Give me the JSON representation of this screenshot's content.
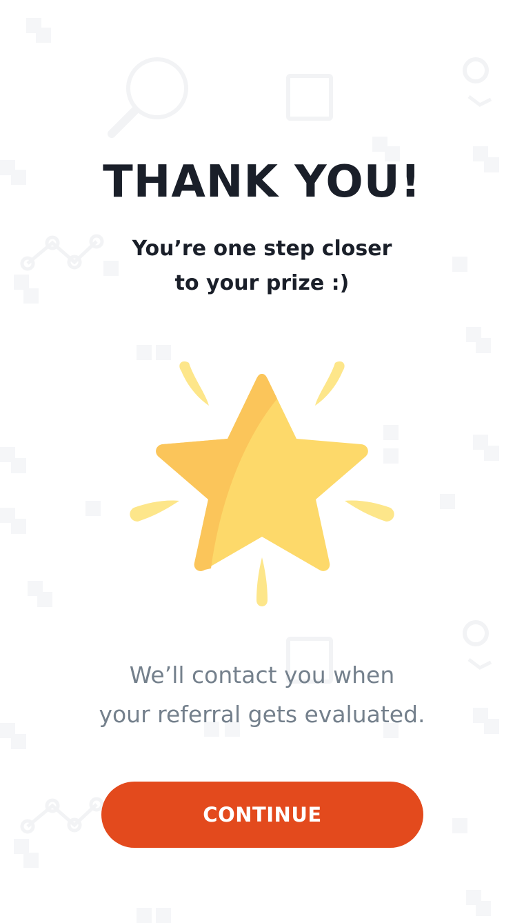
{
  "header": {
    "title": "THANK YOU!",
    "subtitle_lines": [
      "You’re one step closer",
      "to your prize :)"
    ]
  },
  "illustration": {
    "icon": "star-icon",
    "colors": {
      "star_light": "#fdd96a",
      "star_shade": "#fbc55a",
      "rays": "#fde68a"
    }
  },
  "message": {
    "lines": [
      "We’ll contact you when",
      "your referral gets evaluated."
    ]
  },
  "actions": {
    "continue_label": "CONTINUE"
  },
  "theme": {
    "accent": "#e34a1d",
    "heading_text": "#1a1f29",
    "body_text": "#74808c",
    "background": "#ffffff"
  }
}
